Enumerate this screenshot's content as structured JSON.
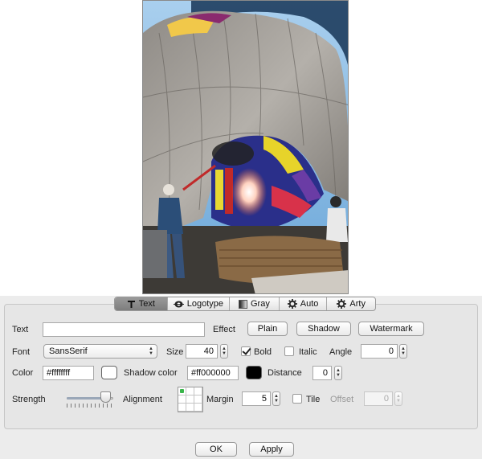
{
  "tabs": [
    {
      "label": "Text",
      "icon": "text-icon",
      "active": true
    },
    {
      "label": "Logotype",
      "icon": "logotype-icon",
      "active": false
    },
    {
      "label": "Gray",
      "icon": "gray-icon",
      "active": false
    },
    {
      "label": "Auto",
      "icon": "auto-gear-icon",
      "active": false
    },
    {
      "label": "Arty",
      "icon": "arty-gear-icon",
      "active": false
    }
  ],
  "text_row": {
    "label": "Text",
    "value": "",
    "effect_label": "Effect",
    "effects": [
      "Plain",
      "Shadow",
      "Watermark"
    ]
  },
  "font_row": {
    "label": "Font",
    "font": "SansSerif",
    "size_label": "Size",
    "size": "40",
    "bold_label": "Bold",
    "bold": true,
    "italic_label": "Italic",
    "italic": false,
    "angle_label": "Angle",
    "angle": "0"
  },
  "color_row": {
    "label": "Color",
    "color": "#ffffffff",
    "color_swatch": "#ffffff",
    "shadow_label": "Shadow color",
    "shadow_color": "#ff000000",
    "shadow_swatch": "#000000",
    "distance_label": "Distance",
    "distance": "0"
  },
  "strength_row": {
    "label": "Strength",
    "strength": 0.86,
    "alignment_label": "Alignment",
    "alignment_selected": "top-left",
    "margin_label": "Margin",
    "margin": "5",
    "tile_label": "Tile",
    "tile": false,
    "offset_label": "Offset",
    "offset": "0"
  },
  "footer": {
    "ok": "OK",
    "apply": "Apply"
  }
}
